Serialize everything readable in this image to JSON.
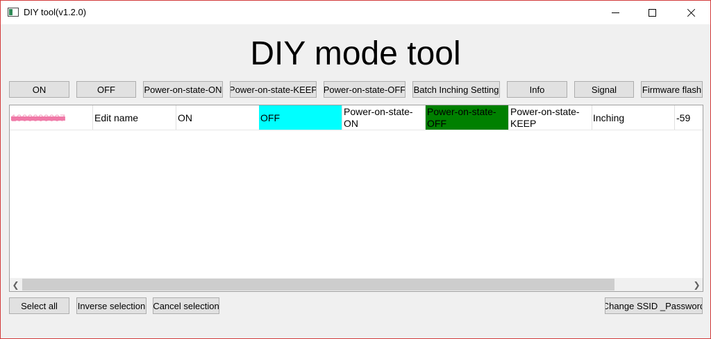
{
  "window": {
    "title": "DIY tool(v1.2.0)"
  },
  "heading": "DIY mode tool",
  "toolbar": [
    {
      "label": "ON"
    },
    {
      "label": "OFF"
    },
    {
      "label": "Power-on-state-ON"
    },
    {
      "label": "Power-on-state-KEEP"
    },
    {
      "label": "Power-on-state-OFF"
    },
    {
      "label": "Batch Inching Setting"
    },
    {
      "label": "Info"
    },
    {
      "label": "Signal"
    },
    {
      "label": "Firmware flash"
    }
  ],
  "table": {
    "rows": [
      {
        "device_id": "1000000007",
        "edit_name": "Edit name",
        "on": "ON",
        "off": "OFF",
        "power_on_state_on": "Power-on-state-ON",
        "power_on_state_off": "Power-on-state-OFF",
        "power_on_state_keep": "Power-on-state-KEEP",
        "inching": "Inching",
        "signal": "-59"
      }
    ]
  },
  "footer": {
    "select_all": "Select all",
    "inverse_selection": "Inverse selection",
    "cancel_selection": "Cancel selection",
    "change_ssid": "Change SSID _Password"
  },
  "colors": {
    "off_highlight": "#00ffff",
    "power_off_highlight": "#008000",
    "window_border": "#d23b3b"
  },
  "icons": {
    "app": "app-window-icon",
    "minimize": "minimize-icon",
    "maximize": "maximize-icon",
    "close": "close-icon",
    "scroll_left": "chevron-left-icon",
    "scroll_right": "chevron-right-icon"
  }
}
